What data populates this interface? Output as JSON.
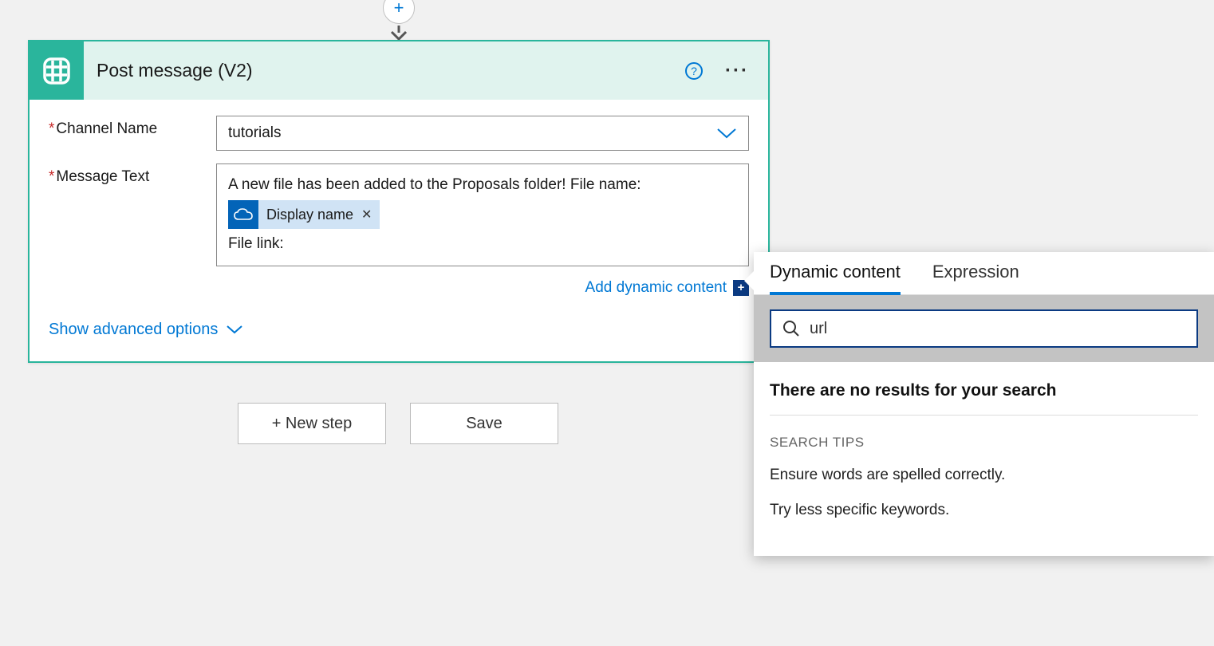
{
  "action": {
    "title": "Post message (V2)",
    "fields": {
      "channel_name": {
        "label": "Channel Name",
        "value": "tutorials"
      },
      "message_text": {
        "label": "Message Text",
        "line1": "A new file has been added to the Proposals folder!  File name:",
        "token_label": "Display name",
        "line3": "File link:"
      }
    },
    "add_dynamic_content": "Add dynamic content",
    "show_advanced": "Show advanced options"
  },
  "buttons": {
    "new_step": "+ New step",
    "save": "Save"
  },
  "flyout": {
    "tabs": {
      "dynamic": "Dynamic content",
      "expression": "Expression"
    },
    "search_value": "url",
    "no_results": "There are no results for your search",
    "search_tips_header": "SEARCH TIPS",
    "tips": {
      "0": "Ensure words are spelled correctly.",
      "1": "Try less specific keywords."
    }
  }
}
